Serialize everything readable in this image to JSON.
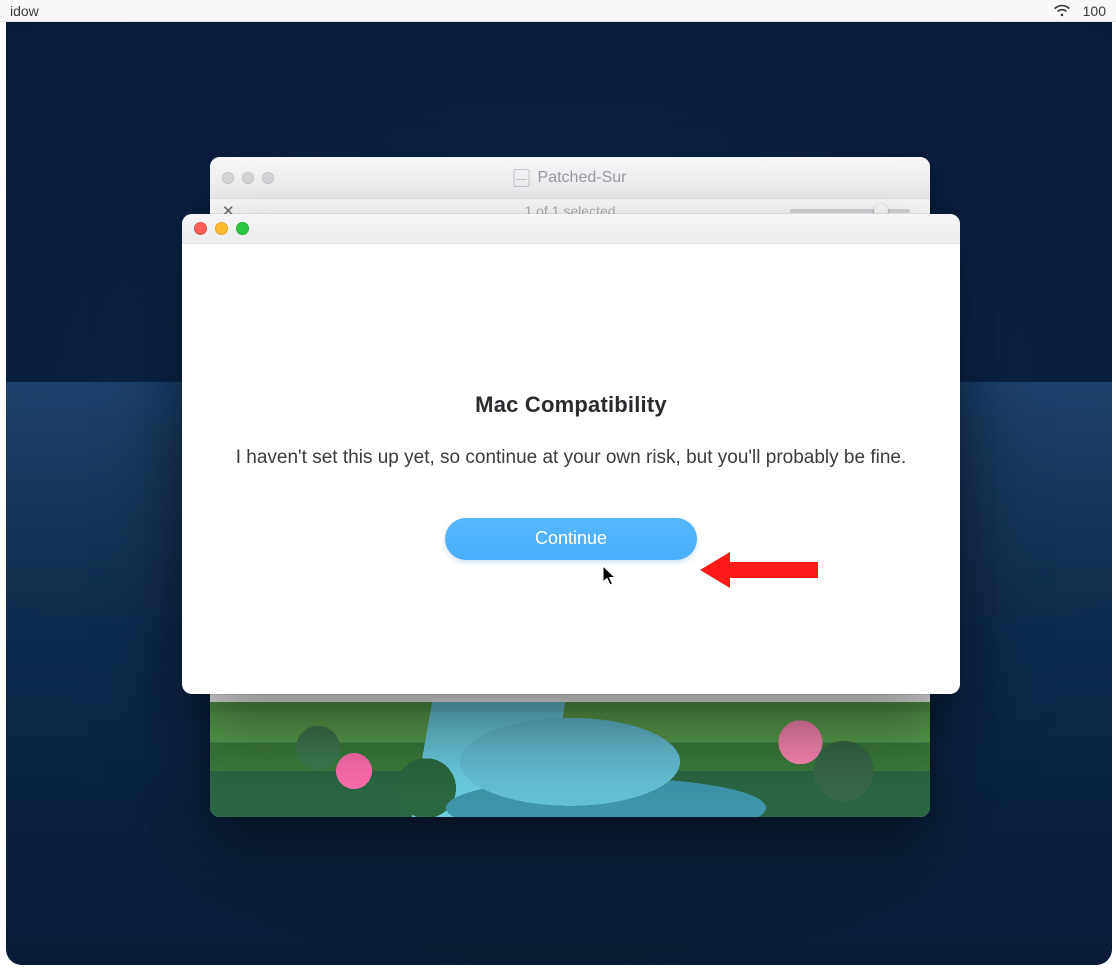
{
  "menubar": {
    "left_fragment": "idow",
    "battery_fragment": "100"
  },
  "bg_window": {
    "title": "Patched-Sur",
    "selection_status": "1 of 1 selected"
  },
  "dialog": {
    "heading": "Mac Compatibility",
    "message": "I haven't set this up yet, so continue at your own risk, but you'll probably be fine.",
    "continue_label": "Continue"
  }
}
